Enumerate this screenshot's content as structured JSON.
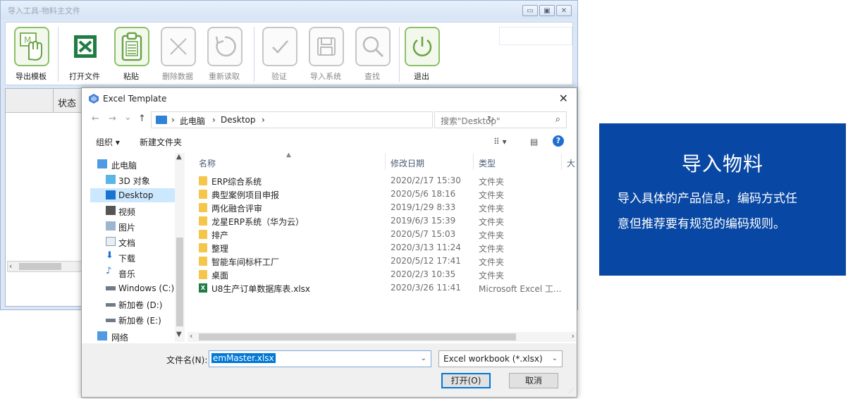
{
  "app": {
    "title": "导入工具-物料主文件",
    "window_buttons": [
      "▭",
      "▣",
      "✕"
    ],
    "toolbar": [
      {
        "label": "导出模板",
        "icon": "hand-template-icon",
        "state": "active"
      },
      {
        "label": "打开文件",
        "icon": "excel-icon",
        "state": "normal"
      },
      {
        "label": "粘贴",
        "icon": "clipboard-icon",
        "state": "active"
      },
      {
        "label": "删除数据",
        "icon": "x-icon",
        "state": "disabled"
      },
      {
        "label": "重新读取",
        "icon": "refresh-icon",
        "state": "disabled"
      },
      {
        "label": "验证",
        "icon": "check-icon",
        "state": "disabled"
      },
      {
        "label": "导入系统",
        "icon": "save-icon",
        "state": "disabled"
      },
      {
        "label": "查找",
        "icon": "magnifier-icon",
        "state": "disabled"
      },
      {
        "label": "退出",
        "icon": "power-icon",
        "state": "active"
      }
    ],
    "grid": {
      "column_label": "状态"
    },
    "scroll_left_arrow": "‹"
  },
  "dialog": {
    "title": "Excel Template",
    "close": "✕",
    "nav": {
      "back": "←",
      "forward": "→",
      "dropdown": "⌄",
      "up": "↑"
    },
    "address": {
      "segments": [
        "此电脑",
        "Desktop"
      ],
      "sep": "›",
      "dropdown": "⌄",
      "refresh": "↻"
    },
    "search": {
      "placeholder": "搜索\"Desktop\"",
      "icon": "⌕"
    },
    "commands": {
      "organize": "组织 ▾",
      "new_folder": "新建文件夹",
      "view": "⠿ ▾",
      "pane": "▤",
      "help": "?"
    },
    "nav_items": [
      {
        "label": "此电脑",
        "icon": "computer-icon",
        "indent": 0,
        "selected": false
      },
      {
        "label": "3D 对象",
        "icon": "3d-objects-icon",
        "indent": 1,
        "selected": false
      },
      {
        "label": "Desktop",
        "icon": "desktop-icon",
        "indent": 1,
        "selected": true
      },
      {
        "label": "视频",
        "icon": "video-icon",
        "indent": 1,
        "selected": false
      },
      {
        "label": "图片",
        "icon": "pictures-icon",
        "indent": 1,
        "selected": false
      },
      {
        "label": "文档",
        "icon": "documents-icon",
        "indent": 1,
        "selected": false
      },
      {
        "label": "下载",
        "icon": "download-icon",
        "indent": 1,
        "selected": false
      },
      {
        "label": "音乐",
        "icon": "music-icon",
        "indent": 1,
        "selected": false
      },
      {
        "label": "Windows (C:)",
        "icon": "drive-icon",
        "indent": 1,
        "selected": false
      },
      {
        "label": "新加卷 (D:)",
        "icon": "drive-icon",
        "indent": 1,
        "selected": false
      },
      {
        "label": "新加卷 (E:)",
        "icon": "drive-icon",
        "indent": 1,
        "selected": false
      },
      {
        "label": "网络",
        "icon": "network-icon",
        "indent": 0,
        "selected": false
      }
    ],
    "columns": {
      "name": "名称",
      "date": "修改日期",
      "type": "类型",
      "size": "大"
    },
    "files": [
      {
        "name": "ERP综合系统",
        "date": "2020/2/17 15:30",
        "type": "文件夹",
        "kind": "folder"
      },
      {
        "name": "典型案例项目申报",
        "date": "2020/5/6 18:16",
        "type": "文件夹",
        "kind": "folder"
      },
      {
        "name": "两化融合评审",
        "date": "2019/1/29 8:33",
        "type": "文件夹",
        "kind": "folder"
      },
      {
        "name": "龙星ERP系统（华为云）",
        "date": "2019/6/3 15:39",
        "type": "文件夹",
        "kind": "folder"
      },
      {
        "name": "排产",
        "date": "2020/5/7 15:03",
        "type": "文件夹",
        "kind": "folder"
      },
      {
        "name": "整理",
        "date": "2020/3/13 11:24",
        "type": "文件夹",
        "kind": "folder"
      },
      {
        "name": "智能车间标杆工厂",
        "date": "2020/5/12 17:41",
        "type": "文件夹",
        "kind": "folder"
      },
      {
        "name": "桌面",
        "date": "2020/2/3 10:35",
        "type": "文件夹",
        "kind": "folder"
      },
      {
        "name": "U8生产订单数据库表.xlsx",
        "date": "2020/3/26 11:41",
        "type": "Microsoft Excel 工...",
        "kind": "excel"
      }
    ],
    "filename_label": "文件名(N):",
    "filename_value": "emMaster.xlsx",
    "filetype": "Excel workbook (*.xlsx)",
    "open_button": "打开(O)",
    "cancel_button": "取消"
  },
  "info_card": {
    "title": "导入物料",
    "lines": [
      "导入具体的产品信息，编码方式任",
      "意但推荐要有规范的编码规则。"
    ],
    "bg_color": "#0848a4"
  }
}
